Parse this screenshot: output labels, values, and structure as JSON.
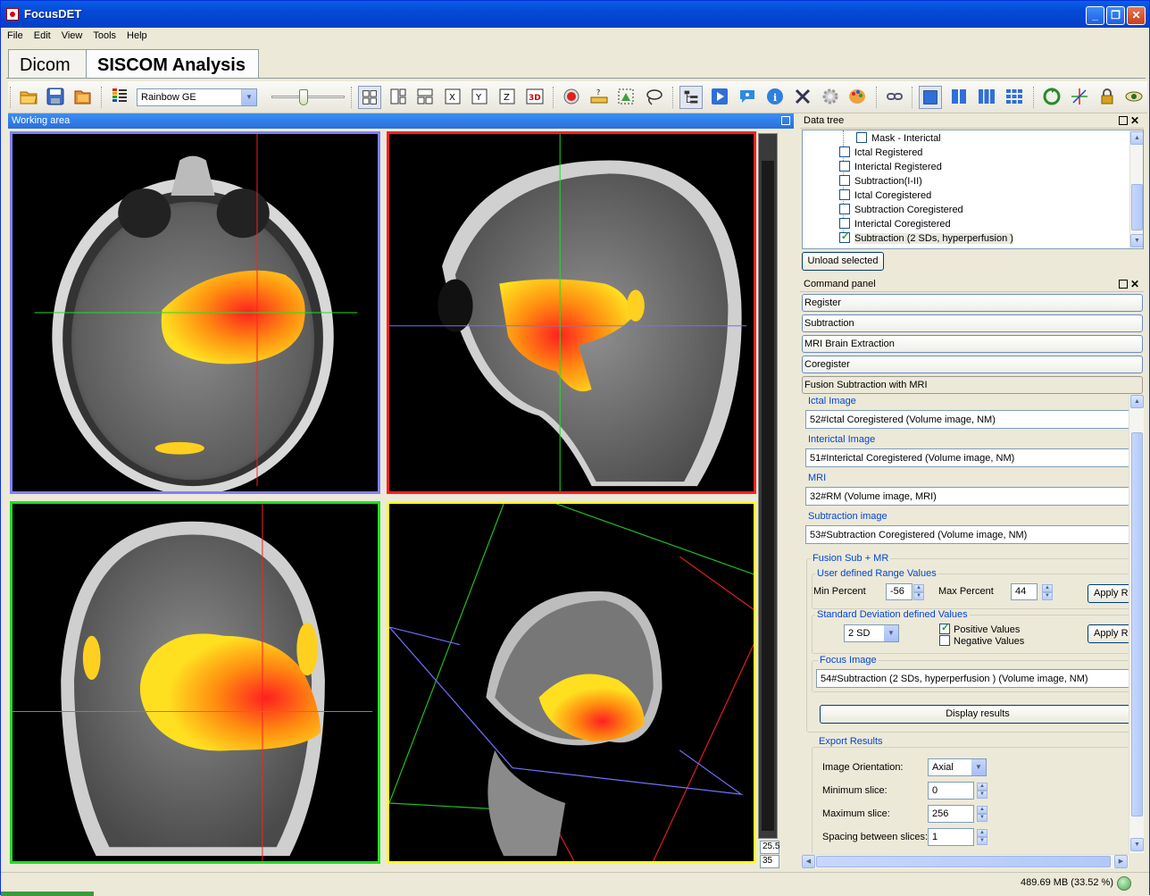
{
  "window": {
    "title": "FocusDET"
  },
  "menu": [
    "File",
    "Edit",
    "View",
    "Tools",
    "Help"
  ],
  "tabs": [
    {
      "label": "Dicom"
    },
    {
      "label": "SISCOM Analysis"
    }
  ],
  "toolbar": {
    "colormap": "Rainbow GE",
    "icons": [
      "open-folder-icon",
      "save-icon",
      "open-recent-icon",
      "palette-icon",
      "layout-2x2-icon",
      "layout-cols-icon",
      "layout-tree-icon",
      "x-axis-icon",
      "y-axis-icon",
      "z-axis-icon",
      "3d-icon",
      "record-icon",
      "measure-icon",
      "roi-icon",
      "lasso-icon",
      "tree-view-icon",
      "play-icon",
      "info-balloon-icon",
      "info-icon",
      "tools-icon",
      "gear-icon",
      "color-palette-icon",
      "link-icon",
      "single-view-icon",
      "two-view-icon",
      "three-view-icon",
      "grid-view-icon",
      "recycle-icon",
      "crosshair-icon",
      "lock-icon",
      "eye-icon"
    ]
  },
  "working_area": {
    "title": "Working area",
    "slice_a": "25.5",
    "slice_b": "35"
  },
  "data_tree": {
    "title": "Data tree",
    "items": [
      {
        "label": "Mask - Interictal",
        "checked": false
      },
      {
        "label": "Ictal Registered",
        "checked": false
      },
      {
        "label": "Interictal Registered",
        "checked": false
      },
      {
        "label": "Subtraction(I-II)",
        "checked": false
      },
      {
        "label": "Ictal Coregistered",
        "checked": false
      },
      {
        "label": "Subtraction Coregistered",
        "checked": false
      },
      {
        "label": "Interictal Coregistered",
        "checked": false
      },
      {
        "label": "Subtraction (2 SDs, hyperperfusion )",
        "checked": true
      }
    ],
    "unload_label": "Unload selected"
  },
  "command_panel": {
    "title": "Command panel",
    "buttons": [
      "Register",
      "Subtraction",
      "MRI Brain Extraction",
      "Coregister",
      "Fusion Subtraction with MRI"
    ],
    "fields": [
      {
        "label": "Ictal Image",
        "value": "52#Ictal Coregistered (Volume image, NM)"
      },
      {
        "label": "Interictal Image",
        "value": "51#Interictal Coregistered (Volume image, NM)"
      },
      {
        "label": "MRI",
        "value": "32#RM (Volume image, MRI)"
      },
      {
        "label": "Subtraction image",
        "value": "53#Subtraction Coregistered (Volume image, NM)"
      }
    ],
    "fusion": {
      "title": "Fusion Sub + MR",
      "range_group": "User defined Range Values",
      "min_label": "Min Percent",
      "min_value": "-56",
      "max_label": "Max Percent",
      "max_value": "44",
      "apply_range": "Apply R",
      "sd_group": "Standard Deviation defined Values",
      "sd_value": "2 SD",
      "positive_label": "Positive Values",
      "positive_checked": true,
      "negative_label": "Negative Values",
      "negative_checked": false,
      "apply_sd": "Apply R",
      "focus_group": "Focus Image",
      "focus_value": "54#Subtraction (2 SDs, hyperperfusion ) (Volume image, NM)",
      "display_results": "Display results"
    },
    "export": {
      "title": "Export Results",
      "orientation_label": "Image Orientation:",
      "orientation_value": "Axial",
      "min_slice_label": "Minimum slice:",
      "min_slice_value": "0",
      "max_slice_label": "Maximum slice:",
      "max_slice_value": "256",
      "spacing_label": "Spacing between slices:",
      "spacing_value": "1"
    }
  },
  "status": {
    "memory": "489.69 MB (33.52 %)"
  },
  "colors": {
    "accent": "#2a6fdc",
    "view_axial": "#8080ff",
    "view_sagittal": "#ff2020",
    "view_coronal": "#20e020",
    "view_3d": "#ffff20"
  }
}
